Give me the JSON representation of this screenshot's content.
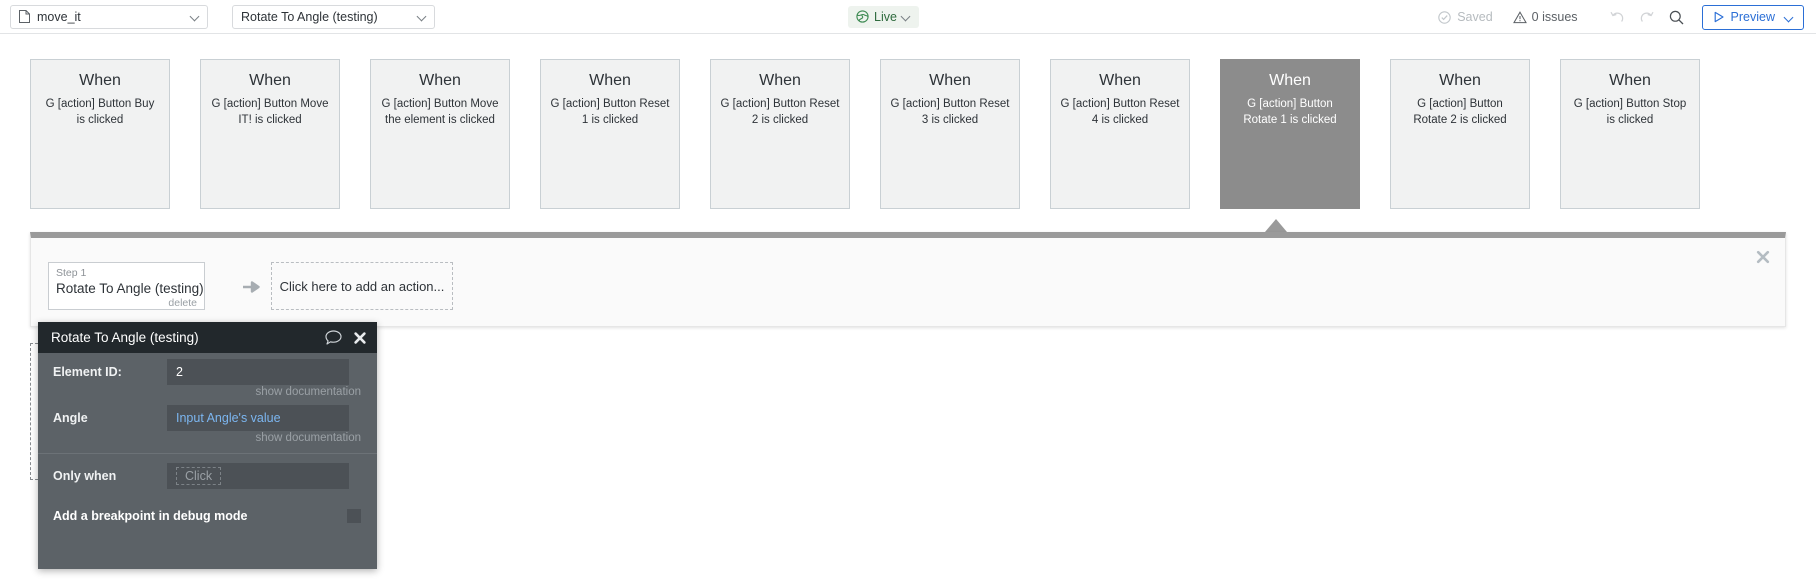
{
  "topbar": {
    "app_select": {
      "value": "move_it",
      "icon": "document-icon",
      "caret": "chevron-down-icon"
    },
    "workflow_select": {
      "value": "Rotate To Angle (testing)",
      "caret": "chevron-down-icon"
    },
    "live_badge": {
      "label": "Live",
      "icon": "globe-icon",
      "caret": "chevron-down-icon",
      "color": "#2f6b3e",
      "bg": "#eef3ee"
    },
    "saved": {
      "label": "Saved",
      "icon": "check-circle-icon",
      "color": "#b6bbbf"
    },
    "issues": {
      "label": "0 issues",
      "icon": "warning-triangle-icon",
      "color": "#5c6166"
    },
    "undo": {
      "icon": "undo-icon",
      "enabled": false
    },
    "redo": {
      "icon": "redo-icon",
      "enabled": false
    },
    "search": {
      "icon": "search-icon"
    },
    "preview": {
      "label": "Preview",
      "icon": "play-icon",
      "caret": "chevron-down-icon",
      "color": "#2b6fd6"
    }
  },
  "events": [
    {
      "when": "When",
      "desc": "G [action] Button Buy is clicked",
      "selected": false
    },
    {
      "when": "When",
      "desc": "G [action] Button Move IT! is clicked",
      "selected": false
    },
    {
      "when": "When",
      "desc": "G [action] Button Move the element is clicked",
      "selected": false
    },
    {
      "when": "When",
      "desc": "G [action] Button Reset 1 is clicked",
      "selected": false
    },
    {
      "when": "When",
      "desc": "G [action] Button Reset 2 is clicked",
      "selected": false
    },
    {
      "when": "When",
      "desc": "G [action] Button Reset 3 is clicked",
      "selected": false
    },
    {
      "when": "When",
      "desc": "G [action] Button Reset 4 is clicked",
      "selected": false
    },
    {
      "when": "When",
      "desc": "G [action] Button Rotate 1 is clicked",
      "selected": true
    },
    {
      "when": "When",
      "desc": "G [action] Button Rotate 2 is clicked",
      "selected": false
    },
    {
      "when": "When",
      "desc": "G [action] Button Stop is clicked",
      "selected": false
    }
  ],
  "step_panel": {
    "close_icon": "close-icon",
    "step": {
      "number_label": "Step 1",
      "name": "Rotate To Angle (testing)",
      "delete_label": "delete"
    },
    "arrow_icon": "arrow-right-icon",
    "add_action_label": "Click here to add an action..."
  },
  "property_popup": {
    "title": "Rotate To Angle (testing)",
    "comment_icon": "comment-bubble-icon",
    "close_icon": "close-icon",
    "fields": [
      {
        "label": "Element ID:",
        "value": "2",
        "is_placeholder": false,
        "doc_label": "show documentation"
      },
      {
        "label": "Angle",
        "value": "Input Angle's value",
        "is_placeholder": true,
        "doc_label": "show documentation"
      }
    ],
    "only_when": {
      "label": "Only when",
      "chip": "Click"
    },
    "breakpoint": {
      "label": "Add a breakpoint in debug mode",
      "checked": false
    }
  }
}
